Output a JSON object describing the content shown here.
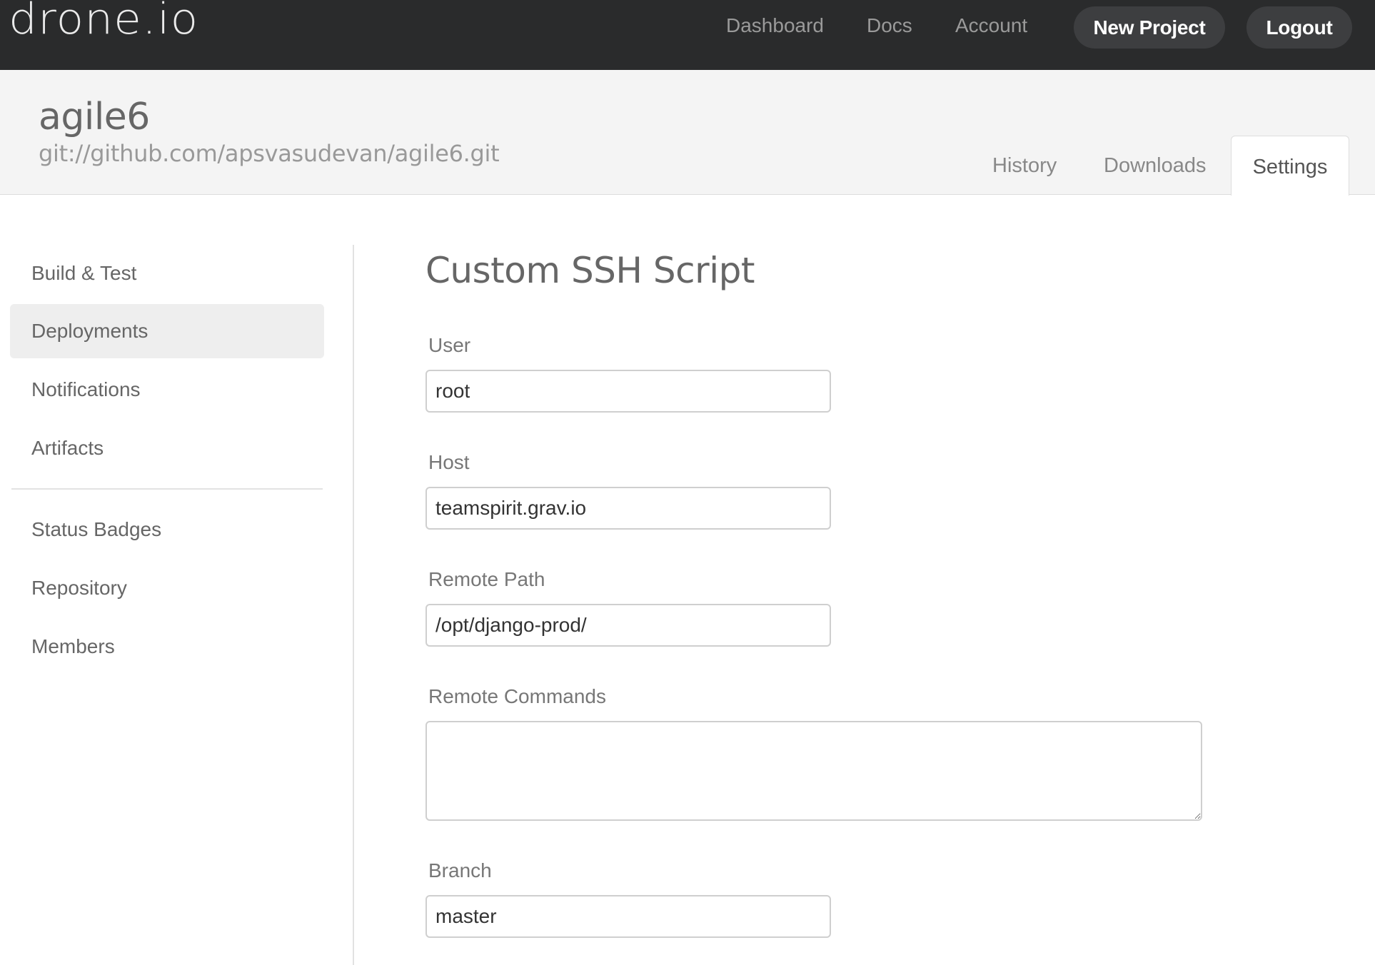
{
  "topbar": {
    "logo": "drone.io",
    "nav": {
      "dashboard": "Dashboard",
      "docs": "Docs",
      "account": "Account",
      "new_project": "New Project",
      "logout": "Logout"
    }
  },
  "project": {
    "name": "agile6",
    "url": "git://github.com/apsvasudevan/agile6.git",
    "tabs": {
      "history": "History",
      "downloads": "Downloads",
      "settings": "Settings"
    },
    "active_tab": "Settings"
  },
  "sidebar": {
    "items": [
      "Build & Test",
      "Deployments",
      "Notifications",
      "Artifacts",
      "Status Badges",
      "Repository",
      "Members"
    ],
    "selected": "Deployments"
  },
  "form": {
    "title": "Custom SSH Script",
    "user": {
      "label": "User",
      "value": "root"
    },
    "host": {
      "label": "Host",
      "value": "teamspirit.grav.io"
    },
    "remote_path": {
      "label": "Remote Path",
      "value": "/opt/django-prod/"
    },
    "remote_commands": {
      "label": "Remote Commands",
      "value": ""
    },
    "branch": {
      "label": "Branch",
      "value": "master"
    }
  }
}
